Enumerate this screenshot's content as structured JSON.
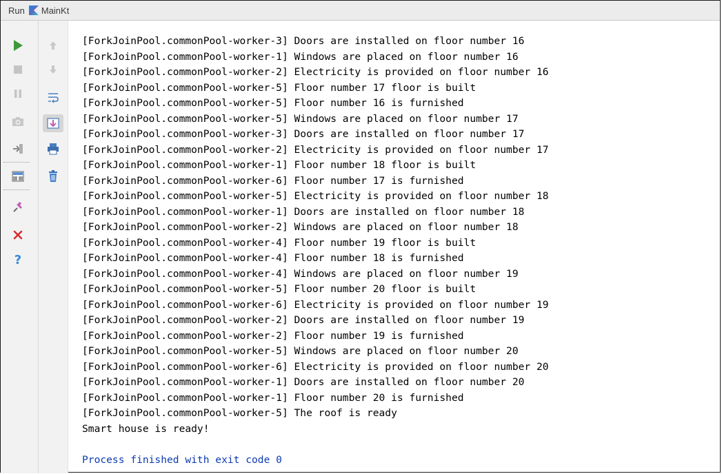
{
  "titlebar": {
    "run_label": "Run",
    "config_name": "MainKt"
  },
  "toolbar": {
    "left_icons": [
      "rerun-icon",
      "stop-icon",
      "pause-icon",
      "dump-threads-icon",
      "restore-layout-icon",
      "layout-icon",
      "pin-tab-icon",
      "close-icon",
      "help-icon"
    ],
    "right_icons": [
      "up-arrow-icon",
      "down-arrow-icon",
      "soft-wrap-icon",
      "scroll-to-end-icon",
      "print-icon",
      "clear-all-icon"
    ]
  },
  "colors": {
    "run_green": "#3c9a3a",
    "close_red": "#d32f2f",
    "help_blue": "#3a87d6",
    "exit_blue": "#0b3bb0"
  },
  "console": {
    "lines": [
      "[ForkJoinPool.commonPool-worker-3] Doors are installed on floor number 16",
      "[ForkJoinPool.commonPool-worker-1] Windows are placed on floor number 16",
      "[ForkJoinPool.commonPool-worker-2] Electricity is provided on floor number 16",
      "[ForkJoinPool.commonPool-worker-5] Floor number 17 floor is built",
      "[ForkJoinPool.commonPool-worker-5] Floor number 16 is furnished",
      "[ForkJoinPool.commonPool-worker-5] Windows are placed on floor number 17",
      "[ForkJoinPool.commonPool-worker-3] Doors are installed on floor number 17",
      "[ForkJoinPool.commonPool-worker-2] Electricity is provided on floor number 17",
      "[ForkJoinPool.commonPool-worker-1] Floor number 18 floor is built",
      "[ForkJoinPool.commonPool-worker-6] Floor number 17 is furnished",
      "[ForkJoinPool.commonPool-worker-5] Electricity is provided on floor number 18",
      "[ForkJoinPool.commonPool-worker-1] Doors are installed on floor number 18",
      "[ForkJoinPool.commonPool-worker-2] Windows are placed on floor number 18",
      "[ForkJoinPool.commonPool-worker-4] Floor number 19 floor is built",
      "[ForkJoinPool.commonPool-worker-4] Floor number 18 is furnished",
      "[ForkJoinPool.commonPool-worker-4] Windows are placed on floor number 19",
      "[ForkJoinPool.commonPool-worker-5] Floor number 20 floor is built",
      "[ForkJoinPool.commonPool-worker-6] Electricity is provided on floor number 19",
      "[ForkJoinPool.commonPool-worker-2] Doors are installed on floor number 19",
      "[ForkJoinPool.commonPool-worker-2] Floor number 19 is furnished",
      "[ForkJoinPool.commonPool-worker-5] Windows are placed on floor number 20",
      "[ForkJoinPool.commonPool-worker-6] Electricity is provided on floor number 20",
      "[ForkJoinPool.commonPool-worker-1] Doors are installed on floor number 20",
      "[ForkJoinPool.commonPool-worker-1] Floor number 20 is furnished",
      "[ForkJoinPool.commonPool-worker-5] The roof is ready",
      "Smart house is ready!"
    ],
    "exit_message": "Process finished with exit code 0"
  }
}
